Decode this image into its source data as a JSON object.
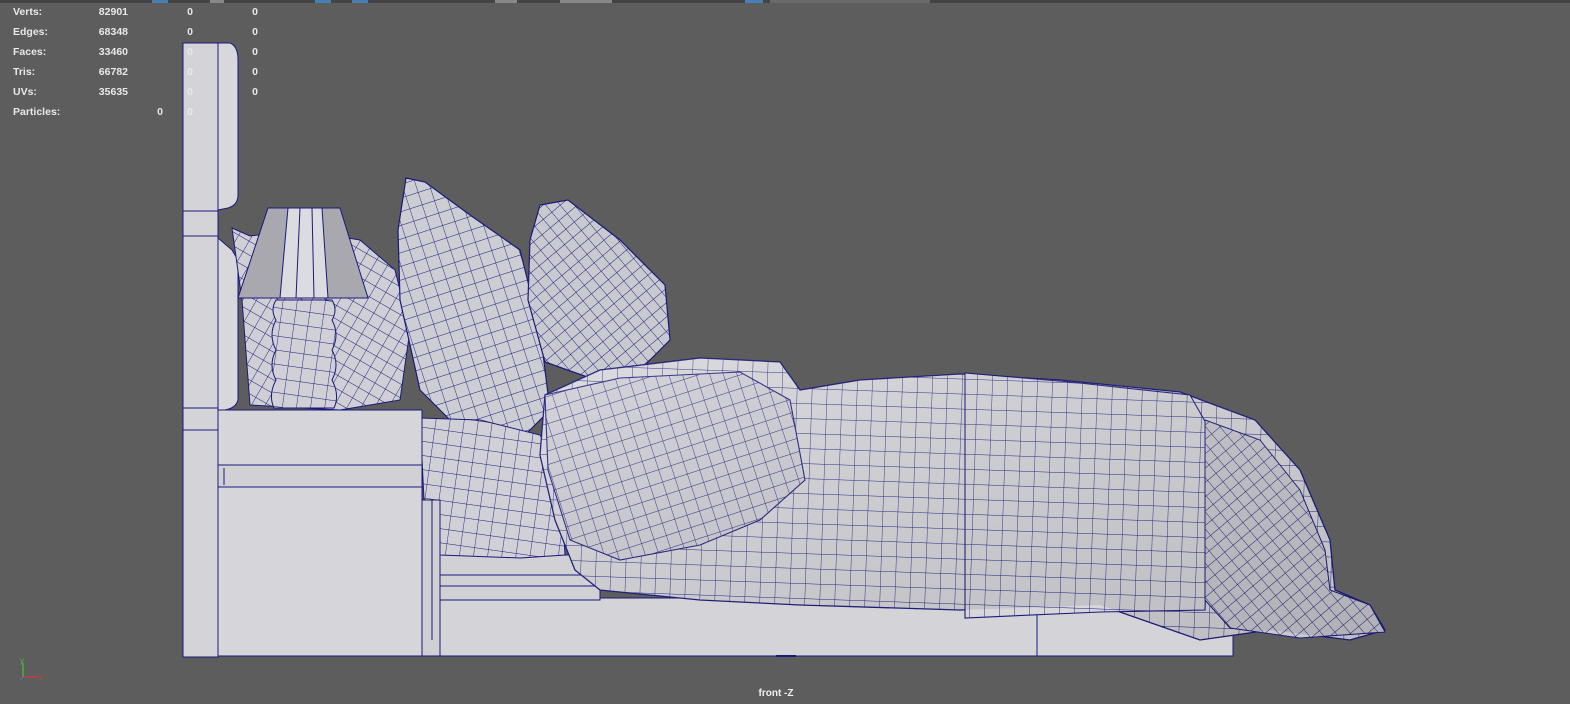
{
  "viewport": {
    "camera_label": "front -Z",
    "background_color": "#5d5d5d",
    "wireframe_color": "#1a1a7a",
    "surface_color": "#d4d4d8"
  },
  "heads_up_display": {
    "rows": [
      {
        "label": "Verts:",
        "values": [
          "82901",
          "0",
          "0"
        ]
      },
      {
        "label": "Edges:",
        "values": [
          "68348",
          "0",
          "0"
        ]
      },
      {
        "label": "Faces:",
        "values": [
          "33460",
          "0",
          "0"
        ]
      },
      {
        "label": "Tris:",
        "values": [
          "66782",
          "0",
          "0"
        ]
      },
      {
        "label": "UVs:",
        "values": [
          "35635",
          "0",
          "0"
        ]
      }
    ],
    "particles": {
      "label": "Particles:",
      "values": [
        "0",
        "0"
      ]
    }
  },
  "axis_gizmo": {
    "y_label": "y",
    "x_label": "x",
    "y_color": "#3fc43f",
    "x_color": "#d83a3a"
  }
}
